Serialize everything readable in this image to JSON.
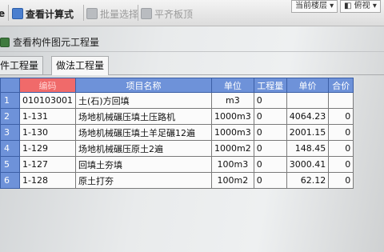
{
  "toolbar": {
    "button1": "查看计算式",
    "button2": "批量选择",
    "button3": "平齐板顶",
    "left_fragment": "e",
    "dropdown1": "当前楼层",
    "dropdown2": "俯视"
  },
  "panel": {
    "title": "查看构件图元工程量"
  },
  "tabs": [
    {
      "label": "件工程量"
    },
    {
      "label": "做法工程量"
    }
  ],
  "table": {
    "headers": [
      "",
      "编码",
      "项目名称",
      "单位",
      "工程量",
      "单价",
      "合价"
    ],
    "rows": [
      {
        "n": "1",
        "code": "010103001",
        "name": "土(石)方回填",
        "unit": "m3",
        "qty": "0",
        "price": "",
        "total": ""
      },
      {
        "n": "2",
        "code": "1-131",
        "name": "场地机械碾压填土压路机",
        "unit": "1000m3",
        "qty": "0",
        "price": "4064.23",
        "total": "0"
      },
      {
        "n": "3",
        "code": "1-130",
        "name": "场地机械碾压填土羊足碾12遍",
        "unit": "1000m3",
        "qty": "0",
        "price": "2001.15",
        "total": "0"
      },
      {
        "n": "4",
        "code": "1-129",
        "name": "场地机械碾压原土2遍",
        "unit": "1000m2",
        "qty": "0",
        "price": "148.45",
        "total": "0"
      },
      {
        "n": "5",
        "code": "1-127",
        "name": "回填土夯填",
        "unit": "100m3",
        "qty": "0",
        "price": "3000.41",
        "total": "0"
      },
      {
        "n": "6",
        "code": "1-128",
        "name": "原土打夯",
        "unit": "100m2",
        "qty": "0",
        "price": "62.12",
        "total": "0"
      }
    ]
  }
}
